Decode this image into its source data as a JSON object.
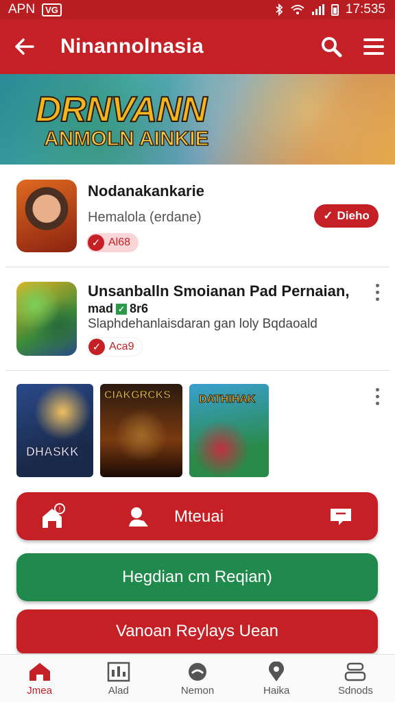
{
  "status_bar": {
    "carrier": "APN",
    "badge": "VG",
    "time": "17:535"
  },
  "app_bar": {
    "title": "Ninannolnasia"
  },
  "banner": {
    "title": "DRNVANN",
    "subtitle": "ANMOLN AINKIE"
  },
  "items": [
    {
      "name": "Nodanakankarie",
      "subtitle": "Hemalola (erdane)",
      "badge": "Al68",
      "action": "Dieho"
    },
    {
      "name": "Unsanballn Smoianan Pad Pernaian,",
      "line1": "mad",
      "line1_tail": "8r6",
      "line2": "Slaphdehanlaisdaran gan loly Bqdaoald",
      "badge": "Aca9"
    }
  ],
  "gallery": {
    "captions": [
      "DHASKK",
      "CIAKGRCKS",
      "DATHIHAK"
    ]
  },
  "buttons": {
    "primary": "Mteuai",
    "green": "Hegdian cm Reqian)",
    "secondary": "Vanoan Reylays Uean"
  },
  "bottom_nav": [
    {
      "label": "Jmea",
      "icon": "home-icon",
      "active": true
    },
    {
      "label": "Alad",
      "icon": "chart-icon",
      "active": false
    },
    {
      "label": "Nemon",
      "icon": "gamepad-icon",
      "active": false
    },
    {
      "label": "Haika",
      "icon": "location-icon",
      "active": false
    },
    {
      "label": "Sdnods",
      "icon": "group-icon",
      "active": false
    }
  ],
  "colors": {
    "primary": "#c42026",
    "primary_dark": "#b81d22",
    "green": "#1f8a4c"
  }
}
